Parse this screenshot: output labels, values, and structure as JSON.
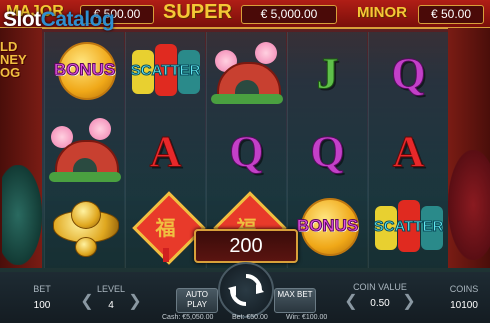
{
  "watermark": {
    "slot": "Slot",
    "catalog": "Catalog"
  },
  "game_title_lines": [
    "LD",
    "NEY",
    "OG"
  ],
  "jackpots": {
    "major": {
      "label": "MAJOR",
      "amount": "€ 500.00"
    },
    "super": {
      "label": "SUPER",
      "amount": "€ 5,000.00"
    },
    "minor": {
      "label": "MINOR",
      "amount": "€ 50.00"
    }
  },
  "reels": [
    [
      "bonus",
      "bridge",
      "gold-ingot"
    ],
    [
      "scatter",
      "A",
      "scroll"
    ],
    [
      "bridge",
      "Q",
      "scroll"
    ],
    [
      "J",
      "Q",
      "bonus"
    ],
    [
      "Q",
      "A",
      "scatter"
    ]
  ],
  "symbol_text": {
    "bonus": "BONUS",
    "scatter": "SCATTER",
    "scroll": "福"
  },
  "win_amount": "200",
  "controls": {
    "bet": {
      "label": "BET",
      "value": "100"
    },
    "level": {
      "label": "LEVEL",
      "value": "4"
    },
    "auto_play": "AUTO PLAY",
    "max_bet": "MAX BET",
    "coin_value": {
      "label": "COIN VALUE",
      "value": "0.50"
    },
    "coins": {
      "label": "COINS",
      "value": "10100"
    }
  },
  "footer": {
    "cash": "Cash: €5,050.00",
    "bet": "Bet: €50.00",
    "win": "Win: €100.00"
  },
  "colors": {
    "accent_gold": "#d8a03a",
    "frame_red": "#b01e16"
  }
}
